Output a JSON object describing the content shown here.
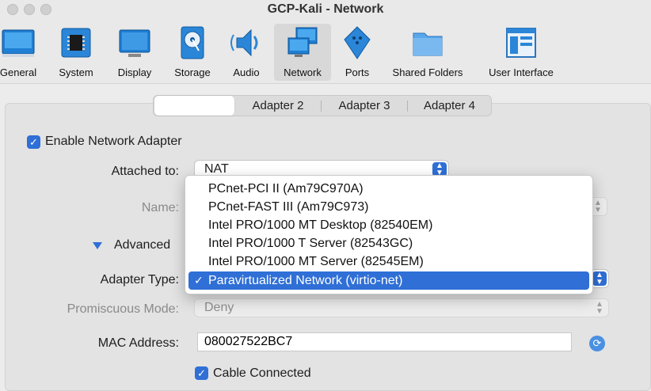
{
  "window": {
    "title": "GCP-Kali - Network"
  },
  "toolbar": {
    "items": [
      {
        "label": "General",
        "icon": "general-icon"
      },
      {
        "label": "System",
        "icon": "chip-icon"
      },
      {
        "label": "Display",
        "icon": "monitor-icon"
      },
      {
        "label": "Storage",
        "icon": "disk-icon"
      },
      {
        "label": "Audio",
        "icon": "speaker-icon"
      },
      {
        "label": "Network",
        "icon": "network-icon",
        "selected": true
      },
      {
        "label": "Ports",
        "icon": "serial-port-icon"
      },
      {
        "label": "Shared Folders",
        "icon": "folder-icon"
      },
      {
        "label": "User Interface",
        "icon": "window-layout-icon"
      }
    ]
  },
  "tabs": [
    "",
    "Adapter 2",
    "Adapter 3",
    "Adapter 4"
  ],
  "form": {
    "enable_label": "Enable Network Adapter",
    "attached_to_label": "Attached to:",
    "attached_to_value": "NAT",
    "name_label": "Name:",
    "advanced_label": "Advanced",
    "adapter_type_label": "Adapter Type:",
    "promiscuous_label": "Promiscuous Mode:",
    "promiscuous_value": "Deny",
    "mac_label": "MAC Address:",
    "mac_value": "080027522BC7",
    "cable_label": "Cable Connected"
  },
  "adapter_menu": {
    "options": [
      "PCnet-PCI II (Am79C970A)",
      "PCnet-FAST III (Am79C973)",
      "Intel PRO/1000 MT Desktop (82540EM)",
      "Intel PRO/1000 T Server (82543GC)",
      "Intel PRO/1000 MT Server (82545EM)",
      "Paravirtualized Network (virtio-net)"
    ],
    "selected": "Paravirtualized Network (virtio-net)"
  },
  "colors": {
    "accent": "#2f6fd6"
  }
}
